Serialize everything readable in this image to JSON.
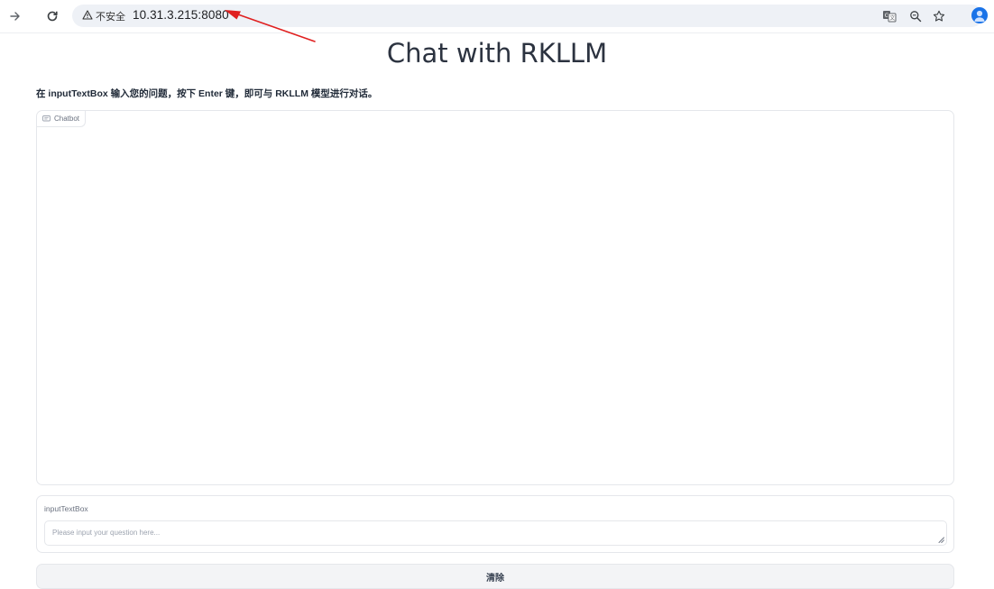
{
  "browser": {
    "security_label": "不安全",
    "url": "10.31.3.215:8080",
    "icons": {
      "forward": "forward-arrow-icon",
      "reload": "reload-icon",
      "warning": "warning-triangle-icon",
      "translate": "translate-icon",
      "zoom": "zoom-icon",
      "bookmark": "star-icon",
      "profile": "profile-avatar-icon"
    },
    "accent_color": "#1a73e8"
  },
  "annotation": {
    "arrow_color": "#e02020"
  },
  "app": {
    "title": "Chat with RKLLM",
    "instructions": "在 inputTextBox 输入您的问题，按下 Enter 键，即可与 RKLLM 模型进行对话。",
    "chatbot": {
      "label": "Chatbot",
      "messages": []
    },
    "input": {
      "label": "inputTextBox",
      "placeholder": "Please input your question here...",
      "value": ""
    },
    "clear_button": "清除"
  }
}
